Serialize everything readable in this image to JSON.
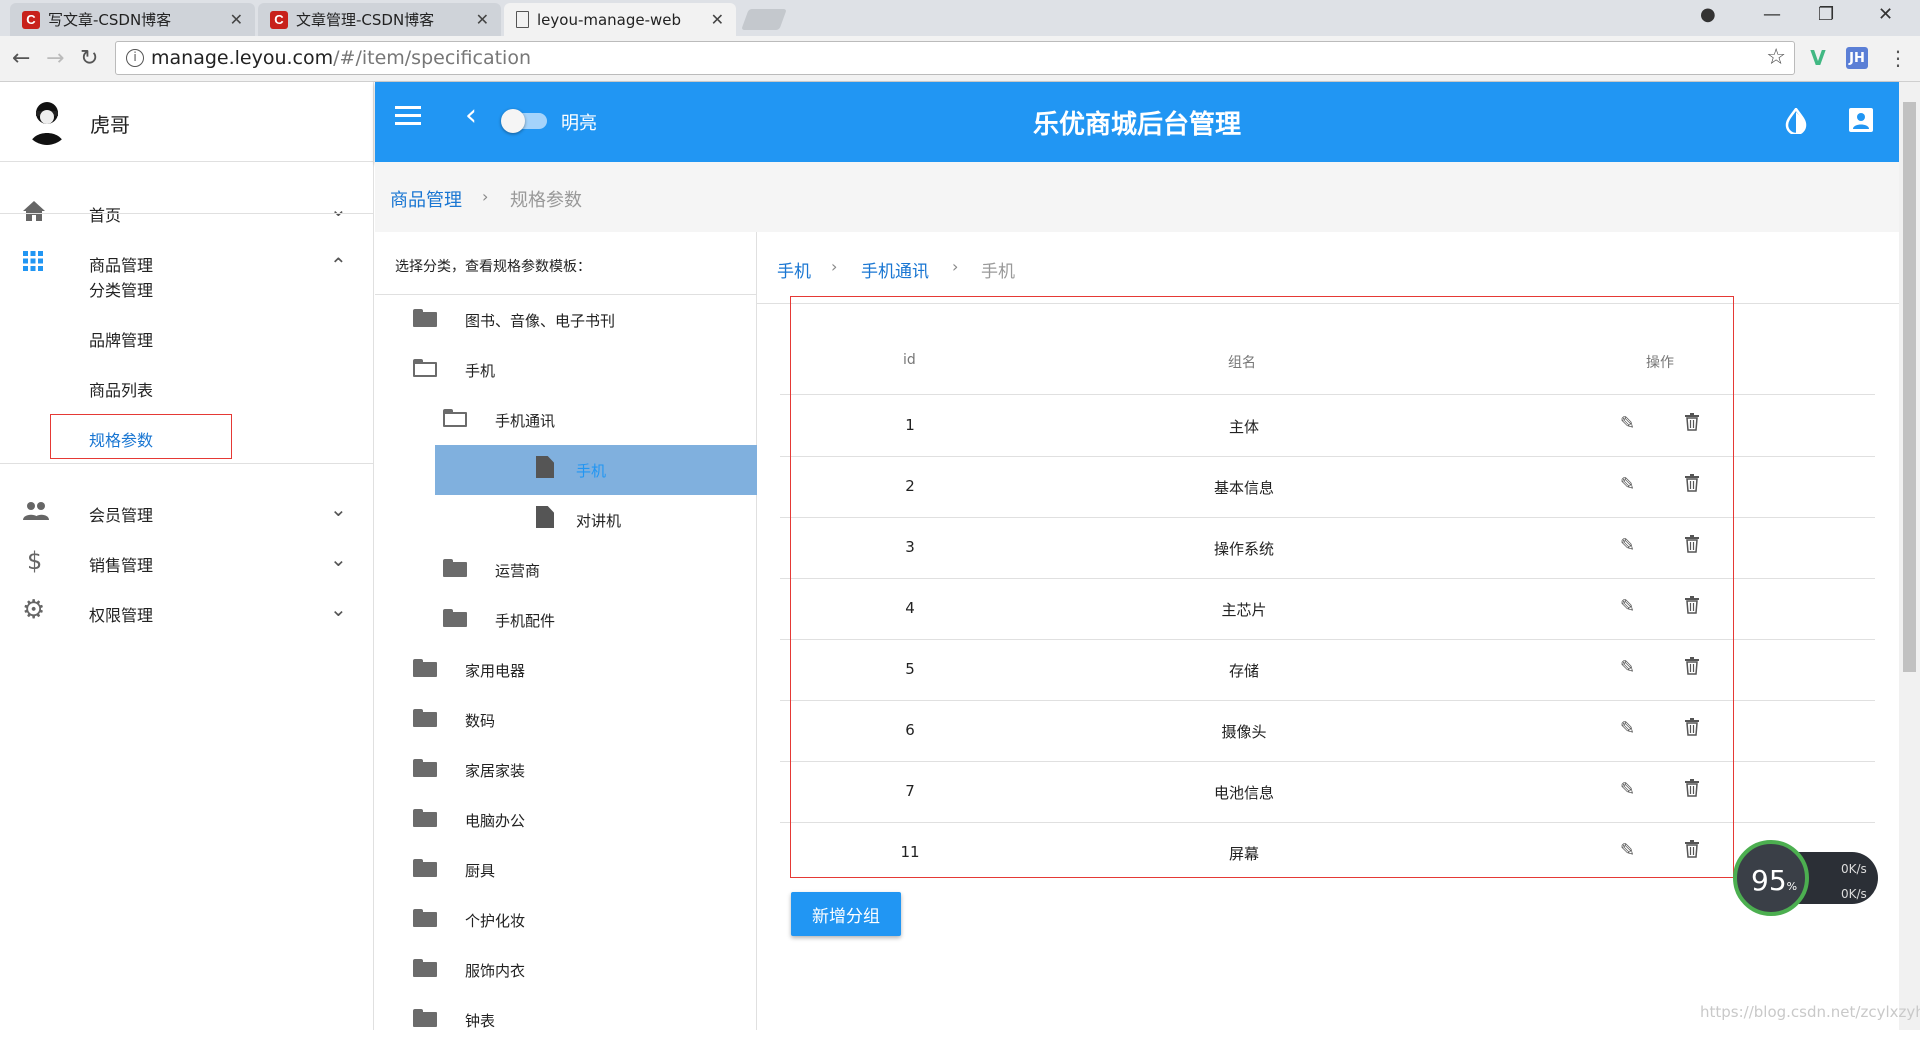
{
  "browser": {
    "tabs": [
      {
        "title": "写文章-CSDN博客",
        "favicon": "C"
      },
      {
        "title": "文章管理-CSDN博客",
        "favicon": "C"
      },
      {
        "title": "leyou-manage-web",
        "favicon": "doc"
      }
    ],
    "url_host": "manage.leyou.com",
    "url_path": "/#/item/specification",
    "extensions": [
      "V",
      "JH"
    ]
  },
  "sidebar": {
    "username": "虎哥",
    "items": [
      {
        "label": "首页",
        "icon": "home-icon"
      },
      {
        "label": "商品管理",
        "icon": "apps-grid-icon"
      },
      {
        "label": "会员管理",
        "icon": "people-icon"
      },
      {
        "label": "销售管理",
        "icon": "dollar-icon"
      },
      {
        "label": "权限管理",
        "icon": "gear-icon"
      }
    ],
    "subitems": [
      "分类管理",
      "品牌管理",
      "商品列表",
      "规格参数"
    ]
  },
  "toolbar": {
    "theme_label": "明亮",
    "title": "乐优商城后台管理"
  },
  "breadcrumb": {
    "parent": "商品管理",
    "current": "规格参数"
  },
  "tree": {
    "hint": "选择分类，查看规格参数模板：",
    "nodes": [
      {
        "label": "图书、音像、电子书刊",
        "type": "folder"
      },
      {
        "label": "手机",
        "type": "folder-open"
      },
      {
        "label": "手机通讯",
        "type": "folder-open"
      },
      {
        "label": "手机",
        "type": "file",
        "selected": true
      },
      {
        "label": "对讲机",
        "type": "file"
      },
      {
        "label": "运营商",
        "type": "folder"
      },
      {
        "label": "手机配件",
        "type": "folder"
      },
      {
        "label": "家用电器",
        "type": "folder"
      },
      {
        "label": "数码",
        "type": "folder"
      },
      {
        "label": "家居家装",
        "type": "folder"
      },
      {
        "label": "电脑办公",
        "type": "folder"
      },
      {
        "label": "厨具",
        "type": "folder"
      },
      {
        "label": "个护化妆",
        "type": "folder"
      },
      {
        "label": "服饰内衣",
        "type": "folder"
      },
      {
        "label": "钟表",
        "type": "folder"
      }
    ]
  },
  "spec": {
    "breadcrumb": [
      "手机",
      "手机通讯",
      "手机"
    ],
    "headers": [
      "id",
      "组名",
      "操作"
    ],
    "rows": [
      {
        "id": "1",
        "name": "主体"
      },
      {
        "id": "2",
        "name": "基本信息"
      },
      {
        "id": "3",
        "name": "操作系统"
      },
      {
        "id": "4",
        "name": "主芯片"
      },
      {
        "id": "5",
        "name": "存储"
      },
      {
        "id": "6",
        "name": "摄像头"
      },
      {
        "id": "7",
        "name": "电池信息"
      },
      {
        "id": "11",
        "name": "屏幕"
      }
    ],
    "add_button": "新增分组"
  },
  "net_meter": {
    "percent": "95",
    "percent_unit": "%",
    "up": "0K/s",
    "down": "0K/s"
  },
  "watermark": "https://blog.csdn.net/zcylxzyh"
}
